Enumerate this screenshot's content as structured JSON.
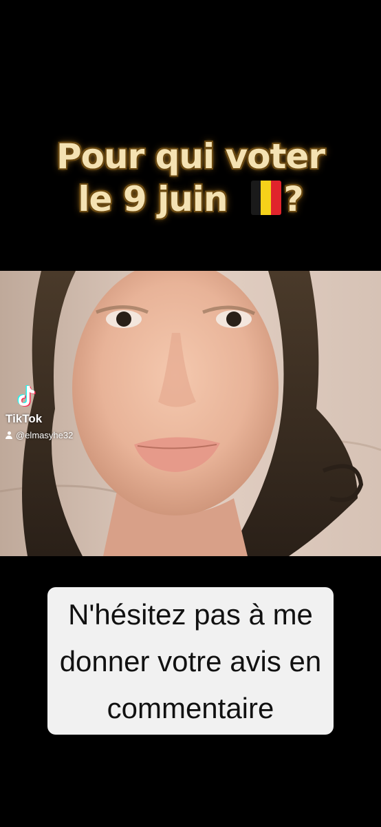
{
  "title": {
    "line1": "Pour qui voter",
    "line2": "le 9 juin",
    "line2_suffix": "?",
    "flag": {
      "icon": "belgium-flag",
      "colors": [
        "#1a1a1a",
        "#f5d11a",
        "#e0242c"
      ]
    }
  },
  "watermark": {
    "logo": "tiktok-logo-icon",
    "app_name": "TikTok",
    "username": "@elmasyhe32",
    "user_icon": "user-icon"
  },
  "caption": {
    "line1": "N'hésitez pas à me",
    "line2": "donner votre avis en",
    "line3": "commentaire"
  }
}
